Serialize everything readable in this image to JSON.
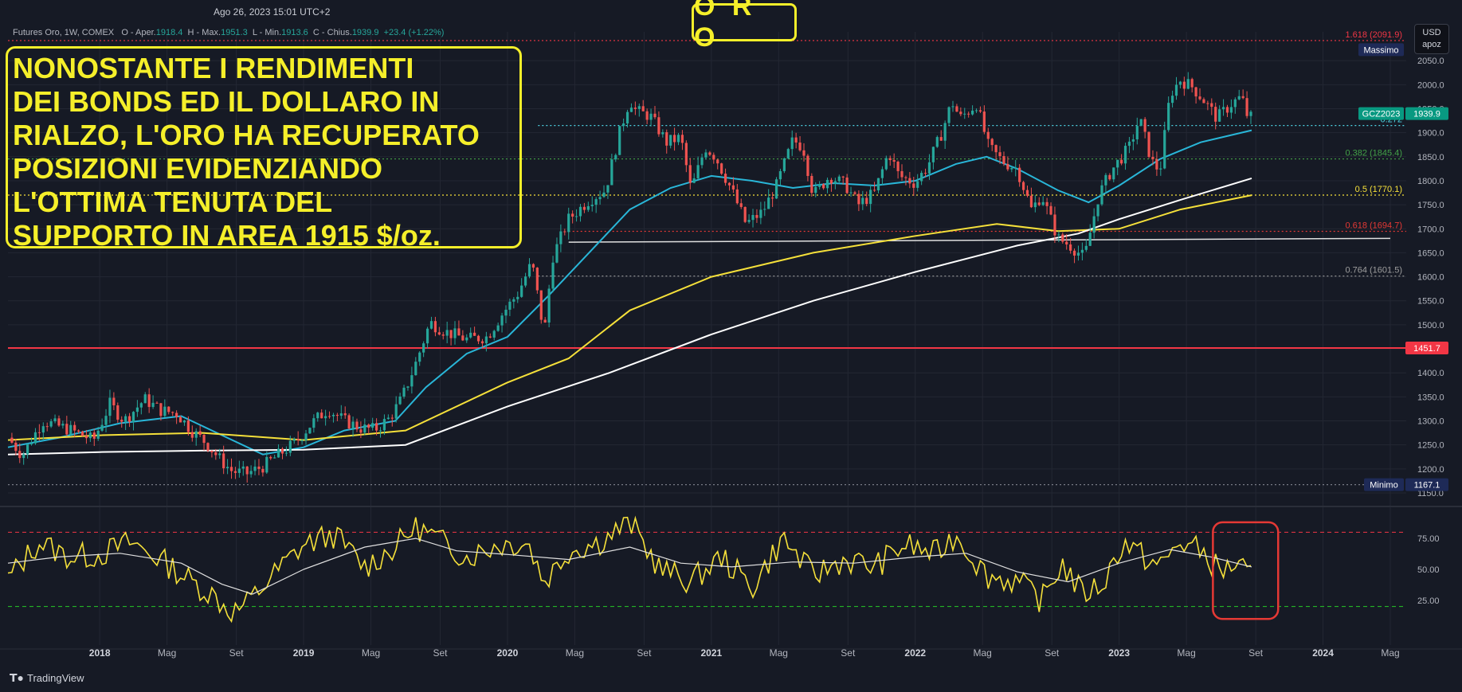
{
  "header": {
    "timestamp": "Ago 26, 2023 15:01 UTC+2",
    "title": "O R O",
    "symbol": "Futures Oro, 1W, COMEX",
    "open_label": "O - Aper.",
    "open": "1918.4",
    "high_label": "H - Max.",
    "high": "1951.3",
    "low_label": "L - Min.",
    "low": "1913.6",
    "close_label": "C - Chius.",
    "close": "1939.9",
    "change": "+23.4 (+1.22%)",
    "currency": "USD",
    "currency_sub": "apoz"
  },
  "annotation": [
    "NONOSTANTE I RENDIMENTI",
    "DEI BONDS ED IL DOLLARO IN",
    "RIALZO, L'ORO HA RECUPERATO",
    "POSIZIONI EVIDENZIANDO",
    "L'OTTIMA TENUTA DEL",
    "SUPPORTO IN AREA 1915 $/oz."
  ],
  "branding": {
    "logo_text": "TradingView"
  },
  "colors": {
    "background": "#161a25",
    "grid": "#232733",
    "axis_text": "#b2b5be",
    "candle_up": "#26a69a",
    "candle_down": "#ef5350",
    "ma_fast": "#29b6d8",
    "ma_mid": "#f5e03a",
    "ma_slow": "#ffffff",
    "rsi": "#f5e03a",
    "rsi_ma": "#e0e0e0",
    "support_red": "#f23645",
    "highlight": "#f5ef2a"
  },
  "chart_data": [
    {
      "type": "candlestick",
      "timeframe": "1W",
      "title": "",
      "xlabel": "",
      "ylabel": "USD apoz",
      "ylim": [
        1140,
        2110
      ],
      "x_range": [
        "2017-08",
        "2024-08"
      ],
      "x_ticks": [
        {
          "label": "2018",
          "t": 2018.0
        },
        {
          "label": "Mag",
          "t": 2018.33
        },
        {
          "label": "Set",
          "t": 2018.67
        },
        {
          "label": "2019",
          "t": 2019.0
        },
        {
          "label": "Mag",
          "t": 2019.33
        },
        {
          "label": "Set",
          "t": 2019.67
        },
        {
          "label": "2020",
          "t": 2020.0
        },
        {
          "label": "Mag",
          "t": 2020.33
        },
        {
          "label": "Set",
          "t": 2020.67
        },
        {
          "label": "2021",
          "t": 2021.0
        },
        {
          "label": "Mag",
          "t": 2021.33
        },
        {
          "label": "Set",
          "t": 2021.67
        },
        {
          "label": "2022",
          "t": 2022.0
        },
        {
          "label": "Mag",
          "t": 2022.33
        },
        {
          "label": "Set",
          "t": 2022.67
        },
        {
          "label": "2023",
          "t": 2023.0
        },
        {
          "label": "Mag",
          "t": 2023.33
        },
        {
          "label": "Set",
          "t": 2023.67
        },
        {
          "label": "2024",
          "t": 2024.0
        },
        {
          "label": "Mag",
          "t": 2024.33
        }
      ],
      "y_ticks": [
        1150,
        1200,
        1250,
        1300,
        1350,
        1400,
        1450,
        1500,
        1550,
        1600,
        1650,
        1700,
        1750,
        1800,
        1850,
        1900,
        1950,
        2000,
        2050
      ],
      "grid": true,
      "price_path": [
        [
          2017.55,
          1265
        ],
        [
          2017.62,
          1228
        ],
        [
          2017.72,
          1300
        ],
        [
          2017.85,
          1282
        ],
        [
          2017.97,
          1260
        ],
        [
          2018.05,
          1335
        ],
        [
          2018.12,
          1300
        ],
        [
          2018.22,
          1345
        ],
        [
          2018.3,
          1322
        ],
        [
          2018.38,
          1315
        ],
        [
          2018.45,
          1280
        ],
        [
          2018.52,
          1255
        ],
        [
          2018.6,
          1215
        ],
        [
          2018.65,
          1195
        ],
        [
          2018.72,
          1190
        ],
        [
          2018.8,
          1205
        ],
        [
          2018.88,
          1230
        ],
        [
          2018.96,
          1255
        ],
        [
          2019.04,
          1295
        ],
        [
          2019.12,
          1325
        ],
        [
          2019.2,
          1300
        ],
        [
          2019.28,
          1285
        ],
        [
          2019.35,
          1282
        ],
        [
          2019.42,
          1305
        ],
        [
          2019.48,
          1345
        ],
        [
          2019.55,
          1420
        ],
        [
          2019.62,
          1505
        ],
        [
          2019.7,
          1485
        ],
        [
          2019.8,
          1470
        ],
        [
          2019.9,
          1475
        ],
        [
          2019.97,
          1520
        ],
        [
          2020.05,
          1565
        ],
        [
          2020.12,
          1630
        ],
        [
          2020.18,
          1480
        ],
        [
          2020.22,
          1640
        ],
        [
          2020.3,
          1720
        ],
        [
          2020.4,
          1760
        ],
        [
          2020.48,
          1780
        ],
        [
          2020.55,
          1900
        ],
        [
          2020.6,
          1970
        ],
        [
          2020.63,
          1945
        ],
        [
          2020.7,
          1935
        ],
        [
          2020.78,
          1880
        ],
        [
          2020.85,
          1890
        ],
        [
          2020.9,
          1780
        ],
        [
          2020.97,
          1870
        ],
        [
          2021.02,
          1850
        ],
        [
          2021.1,
          1780
        ],
        [
          2021.17,
          1710
        ],
        [
          2021.25,
          1735
        ],
        [
          2021.32,
          1790
        ],
        [
          2021.4,
          1885
        ],
        [
          2021.45,
          1870
        ],
        [
          2021.5,
          1770
        ],
        [
          2021.58,
          1810
        ],
        [
          2021.66,
          1790
        ],
        [
          2021.72,
          1750
        ],
        [
          2021.8,
          1775
        ],
        [
          2021.87,
          1860
        ],
        [
          2021.92,
          1810
        ],
        [
          2022.0,
          1795
        ],
        [
          2022.06,
          1830
        ],
        [
          2022.13,
          1900
        ],
        [
          2022.18,
          1965
        ],
        [
          2022.22,
          1930
        ],
        [
          2022.3,
          1960
        ],
        [
          2022.36,
          1870
        ],
        [
          2022.43,
          1840
        ],
        [
          2022.5,
          1825
        ],
        [
          2022.57,
          1740
        ],
        [
          2022.62,
          1770
        ],
        [
          2022.7,
          1680
        ],
        [
          2022.76,
          1665
        ],
        [
          2022.83,
          1640
        ],
        [
          2022.9,
          1770
        ],
        [
          2022.96,
          1820
        ],
        [
          2023.05,
          1870
        ],
        [
          2023.1,
          1930
        ],
        [
          2023.16,
          1840
        ],
        [
          2023.2,
          1820
        ],
        [
          2023.25,
          1980
        ],
        [
          2023.3,
          2010
        ],
        [
          2023.36,
          1995
        ],
        [
          2023.42,
          1965
        ],
        [
          2023.48,
          1930
        ],
        [
          2023.55,
          1960
        ],
        [
          2023.6,
          1975
        ],
        [
          2023.64,
          1920
        ],
        [
          2023.65,
          1939.9
        ]
      ],
      "moving_averages": [
        {
          "color": "ma_fast",
          "points": [
            [
              2017.55,
              1245
            ],
            [
              2017.8,
              1265
            ],
            [
              2018.1,
              1295
            ],
            [
              2018.4,
              1310
            ],
            [
              2018.6,
              1270
            ],
            [
              2018.8,
              1230
            ],
            [
              2019.0,
              1245
            ],
            [
              2019.2,
              1280
            ],
            [
              2019.45,
              1300
            ],
            [
              2019.6,
              1370
            ],
            [
              2019.8,
              1440
            ],
            [
              2020.0,
              1475
            ],
            [
              2020.2,
              1560
            ],
            [
              2020.4,
              1650
            ],
            [
              2020.6,
              1740
            ],
            [
              2020.8,
              1785
            ],
            [
              2021.0,
              1810
            ],
            [
              2021.2,
              1800
            ],
            [
              2021.4,
              1785
            ],
            [
              2021.6,
              1795
            ],
            [
              2021.8,
              1790
            ],
            [
              2022.0,
              1800
            ],
            [
              2022.2,
              1835
            ],
            [
              2022.35,
              1850
            ],
            [
              2022.5,
              1825
            ],
            [
              2022.7,
              1780
            ],
            [
              2022.85,
              1755
            ],
            [
              2023.0,
              1790
            ],
            [
              2023.2,
              1845
            ],
            [
              2023.4,
              1880
            ],
            [
              2023.65,
              1905
            ]
          ]
        },
        {
          "color": "ma_mid",
          "points": [
            [
              2017.55,
              1260
            ],
            [
              2018.0,
              1270
            ],
            [
              2018.5,
              1275
            ],
            [
              2019.0,
              1260
            ],
            [
              2019.5,
              1280
            ],
            [
              2020.0,
              1380
            ],
            [
              2020.3,
              1430
            ],
            [
              2020.6,
              1530
            ],
            [
              2021.0,
              1600
            ],
            [
              2021.5,
              1650
            ],
            [
              2022.0,
              1685
            ],
            [
              2022.4,
              1710
            ],
            [
              2022.7,
              1695
            ],
            [
              2023.0,
              1700
            ],
            [
              2023.3,
              1740
            ],
            [
              2023.65,
              1770
            ]
          ]
        },
        {
          "color": "ma_slow",
          "points": [
            [
              2017.55,
              1230
            ],
            [
              2018.0,
              1235
            ],
            [
              2018.5,
              1238
            ],
            [
              2019.0,
              1240
            ],
            [
              2019.5,
              1250
            ],
            [
              2020.0,
              1330
            ],
            [
              2020.5,
              1400
            ],
            [
              2021.0,
              1480
            ],
            [
              2021.5,
              1550
            ],
            [
              2022.0,
              1610
            ],
            [
              2022.5,
              1665
            ],
            [
              2022.8,
              1690
            ],
            [
              2023.0,
              1720
            ],
            [
              2023.3,
              1760
            ],
            [
              2023.65,
              1805
            ]
          ]
        }
      ],
      "horizontal_levels": [
        {
          "label": "1.618 (2091.9)",
          "value": 2091.9,
          "color": "#f23645",
          "style": "dotted",
          "start": 2017.55
        },
        {
          "label": "0.272",
          "value": 1915,
          "color": "#4dd0e1",
          "style": "dotted",
          "start": 2020.15
        },
        {
          "label": "0.382 (1845.4)",
          "value": 1845.4,
          "color": "#43a047",
          "style": "dotted",
          "start": 2017.55
        },
        {
          "label": "0.5 (1770.1)",
          "value": 1770.1,
          "color": "#f5e03a",
          "style": "dotted",
          "start": 2017.55
        },
        {
          "label": "0.618 (1694.7)",
          "value": 1694.7,
          "color": "#e53935",
          "style": "dotted",
          "start": 2020.3
        },
        {
          "label": "0.764 (1601.5)",
          "value": 1601.5,
          "color": "#9e9e9e",
          "style": "dotted",
          "start": 2020.15
        },
        {
          "label": "",
          "value": 1451.7,
          "color": "#f23645",
          "style": "solid",
          "start": 2017.55
        },
        {
          "label": "",
          "value": 1167.1,
          "color": "#787b86",
          "style": "dotted",
          "start": 2017.55
        }
      ],
      "support_line": {
        "from": [
          2020.3,
          1672
        ],
        "to": [
          2024.33,
          1680
        ]
      },
      "price_labels": [
        {
          "text": "Massimo",
          "value": 2073,
          "bg": "#1e2a57",
          "x": "left"
        },
        {
          "text": "GCZ2023",
          "value": 1939.9,
          "bg": "#089981",
          "x": "left"
        },
        {
          "text": "1939.9",
          "value": 1939.9,
          "bg": "#089981",
          "x": "axis"
        },
        {
          "text": "1451.7",
          "value": 1451.7,
          "bg": "#f23645",
          "x": "axis"
        },
        {
          "text": "Minimo",
          "value": 1167.1,
          "bg": "#1e2a57",
          "x": "left"
        },
        {
          "text": "1167.1",
          "value": 1167.1,
          "bg": "#1e2a57",
          "x": "axis"
        }
      ]
    },
    {
      "type": "line",
      "indicator": "RSI",
      "ylim": [
        5,
        95
      ],
      "y_ticks": [
        25,
        50,
        75
      ],
      "y_tick_labels": [
        "25.00",
        "50.00",
        "75.00"
      ],
      "bands": [
        {
          "value": 80,
          "color": "#f23645"
        },
        {
          "value": 20,
          "color": "#26c926"
        }
      ],
      "x_range": [
        "2017-08",
        "2023-09"
      ],
      "rsi_anchors": [
        [
          2017.55,
          42
        ],
        [
          2017.7,
          72
        ],
        [
          2017.85,
          60
        ],
        [
          2018.0,
          62
        ],
        [
          2018.15,
          72
        ],
        [
          2018.3,
          58
        ],
        [
          2018.45,
          40
        ],
        [
          2018.55,
          30
        ],
        [
          2018.65,
          15
        ],
        [
          2018.72,
          22
        ],
        [
          2018.85,
          45
        ],
        [
          2019.0,
          70
        ],
        [
          2019.15,
          78
        ],
        [
          2019.3,
          52
        ],
        [
          2019.45,
          68
        ],
        [
          2019.55,
          85
        ],
        [
          2019.65,
          75
        ],
        [
          2019.8,
          60
        ],
        [
          2019.95,
          70
        ],
        [
          2020.1,
          72
        ],
        [
          2020.18,
          40
        ],
        [
          2020.3,
          65
        ],
        [
          2020.45,
          72
        ],
        [
          2020.6,
          88
        ],
        [
          2020.75,
          50
        ],
        [
          2020.9,
          40
        ],
        [
          2021.05,
          60
        ],
        [
          2021.2,
          35
        ],
        [
          2021.35,
          75
        ],
        [
          2021.5,
          45
        ],
        [
          2021.65,
          58
        ],
        [
          2021.8,
          52
        ],
        [
          2021.95,
          70
        ],
        [
          2022.1,
          62
        ],
        [
          2022.2,
          78
        ],
        [
          2022.35,
          45
        ],
        [
          2022.5,
          40
        ],
        [
          2022.62,
          25
        ],
        [
          2022.72,
          55
        ],
        [
          2022.82,
          30
        ],
        [
          2022.92,
          38
        ],
        [
          2023.02,
          72
        ],
        [
          2023.12,
          60
        ],
        [
          2023.2,
          52
        ],
        [
          2023.3,
          72
        ],
        [
          2023.4,
          65
        ],
        [
          2023.5,
          48
        ],
        [
          2023.58,
          55
        ],
        [
          2023.65,
          42
        ]
      ],
      "rsi_ma": [
        [
          2017.55,
          55
        ],
        [
          2017.8,
          60
        ],
        [
          2018.1,
          63
        ],
        [
          2018.4,
          55
        ],
        [
          2018.6,
          38
        ],
        [
          2018.75,
          30
        ],
        [
          2019.0,
          50
        ],
        [
          2019.3,
          68
        ],
        [
          2019.55,
          75
        ],
        [
          2019.75,
          65
        ],
        [
          2020.0,
          62
        ],
        [
          2020.3,
          58
        ],
        [
          2020.6,
          68
        ],
        [
          2020.85,
          55
        ],
        [
          2021.1,
          52
        ],
        [
          2021.4,
          56
        ],
        [
          2021.7,
          55
        ],
        [
          2022.0,
          60
        ],
        [
          2022.25,
          63
        ],
        [
          2022.5,
          48
        ],
        [
          2022.75,
          40
        ],
        [
          2023.0,
          55
        ],
        [
          2023.25,
          66
        ],
        [
          2023.45,
          60
        ],
        [
          2023.65,
          52
        ]
      ],
      "highlight_box": {
        "x0": 2023.46,
        "x1": 2023.78,
        "y0": 88,
        "y1": 10,
        "color": "#e53935"
      }
    }
  ]
}
